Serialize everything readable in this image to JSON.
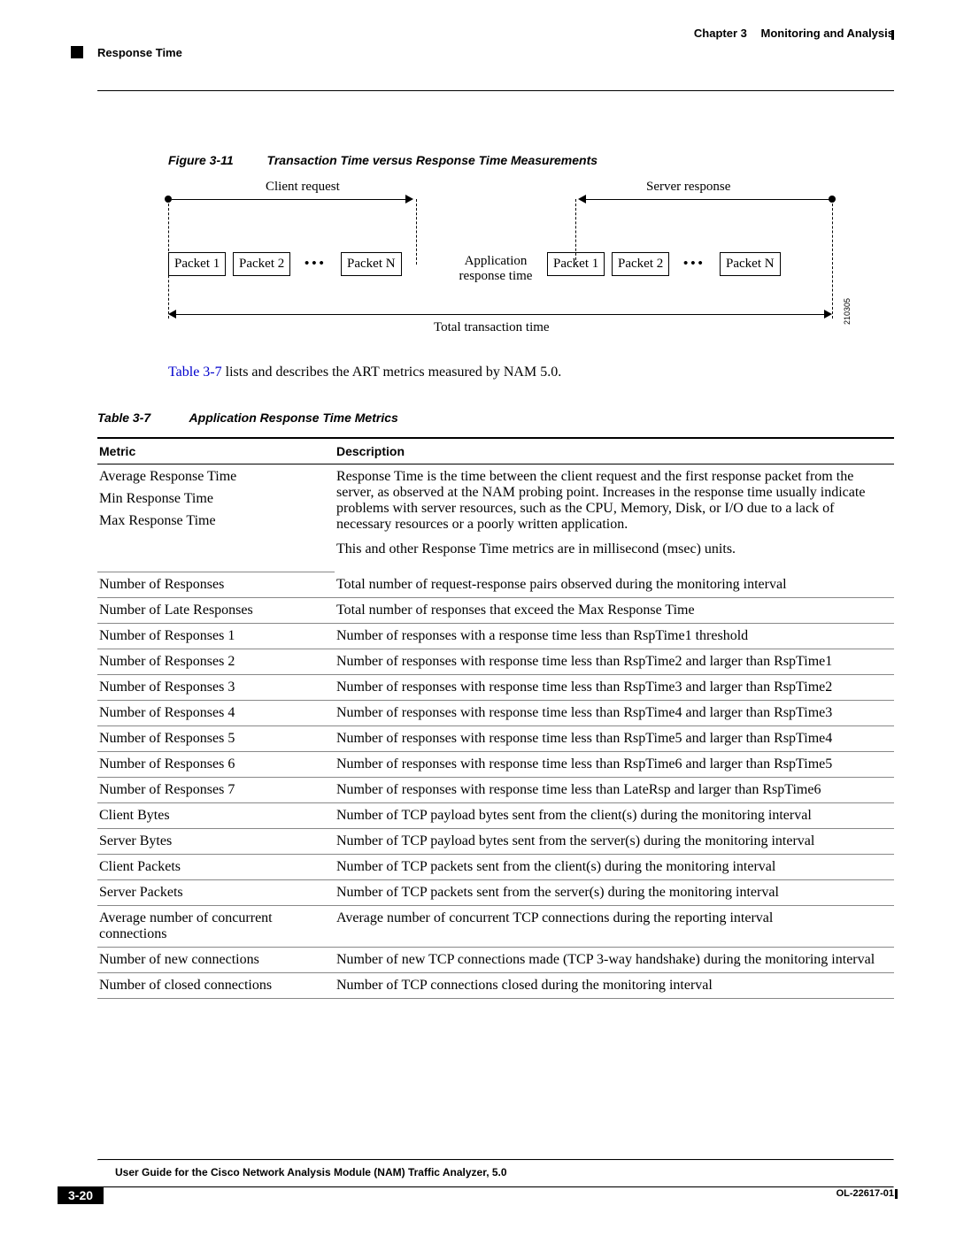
{
  "header": {
    "chapter": "Chapter 3",
    "chapTitle": "Monitoring and Analysis",
    "section": "Response Time"
  },
  "figure": {
    "num": "Figure 3-11",
    "title": "Transaction Time versus Response Time Measurements",
    "clientReq": "Client request",
    "serverResp": "Server response",
    "p1": "Packet 1",
    "p2": "Packet 2",
    "pn": "Packet N",
    "art": "Application\nresponse time",
    "sp1": "Packet 1",
    "sp2": "Packet 2",
    "spn": "Packet N",
    "total": "Total transaction time",
    "id": "210305"
  },
  "para": {
    "xref": "Table 3-7",
    "rest": " lists and describes the ART metrics measured by NAM 5.0."
  },
  "tableCap": {
    "num": "Table 3-7",
    "title": "Application Response Time Metrics"
  },
  "th": {
    "metric": "Metric",
    "desc": "Description"
  },
  "respGroup": {
    "m1": "Average Response Time",
    "m2": "Min Response Time",
    "m3": "Max Response Time",
    "d1": "Response Time is the time between the client request and the first response packet from the server, as observed at the NAM probing point. Increases in the response time usually indicate problems with server resources, such as the CPU, Memory, Disk, or I/O due to a lack of necessary resources or a poorly written application.",
    "d2": "This and other Response Time metrics are in millisecond (msec) units."
  },
  "rows": [
    {
      "m": "Number of Responses",
      "d": "Total number of request-response pairs observed during the monitoring interval"
    },
    {
      "m": "Number of Late Responses",
      "d": "Total number of responses that exceed the Max Response Time"
    },
    {
      "m": "Number of Responses 1",
      "d": "Number of responses with a response time less than RspTime1 threshold"
    },
    {
      "m": "Number of Responses 2",
      "d": "Number of responses with response time less than RspTime2 and larger than RspTime1"
    },
    {
      "m": "Number of Responses 3",
      "d": "Number of responses with response time less than RspTime3 and larger than RspTime2"
    },
    {
      "m": "Number of Responses 4",
      "d": "Number of responses with response time less than RspTime4 and larger than RspTime3"
    },
    {
      "m": "Number of Responses 5",
      "d": "Number of responses with response time less than RspTime5 and larger than RspTime4"
    },
    {
      "m": "Number of Responses 6",
      "d": "Number of responses with response time less than RspTime6 and larger than RspTime5"
    },
    {
      "m": "Number of Responses 7",
      "d": "Number of responses with response time less than LateRsp and larger than RspTime6"
    },
    {
      "m": "Client Bytes",
      "d": "Number of TCP payload bytes sent from the client(s) during the monitoring interval"
    },
    {
      "m": "Server Bytes",
      "d": "Number of TCP payload bytes sent from the server(s) during the monitoring interval"
    },
    {
      "m": "Client Packets",
      "d": "Number of TCP packets sent from the client(s) during the monitoring interval"
    },
    {
      "m": "Server Packets",
      "d": "Number of TCP packets sent from the server(s) during the monitoring interval"
    },
    {
      "m": "Average number of concurrent connections",
      "d": "Average number of concurrent TCP connections during the reporting interval"
    },
    {
      "m": "Number of new connections",
      "d": "Number of new TCP connections made (TCP 3-way handshake) during the monitoring interval"
    },
    {
      "m": "Number of closed connections",
      "d": "Number of TCP connections closed during the monitoring interval"
    }
  ],
  "footer": {
    "guide": "User Guide for the Cisco Network Analysis Module (NAM) Traffic Analyzer, 5.0",
    "page": "3-20",
    "code": "OL-22617-01"
  }
}
